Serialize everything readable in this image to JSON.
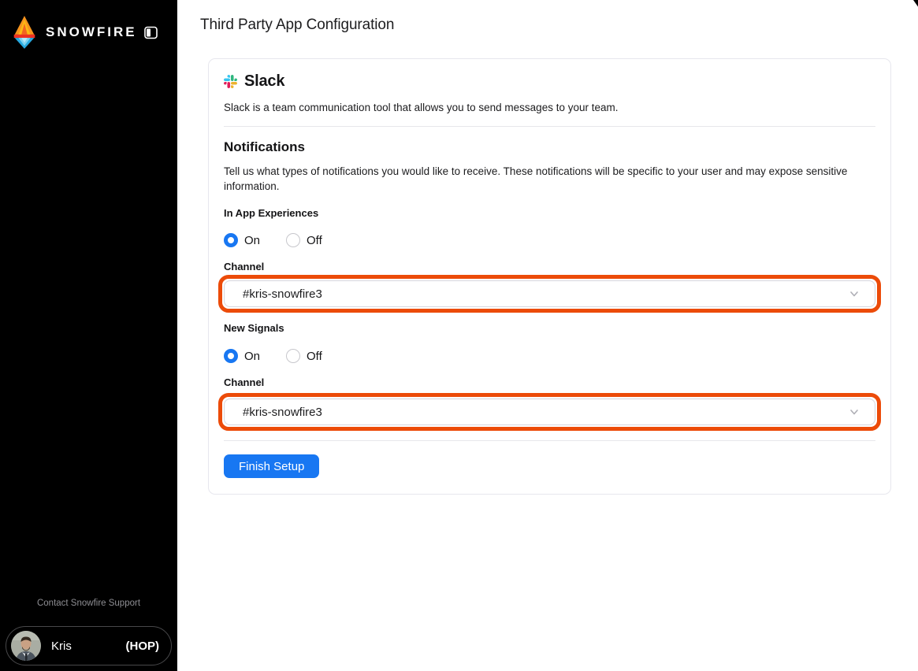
{
  "sidebar": {
    "brand": "SNOWFIRE",
    "support_link": "Contact Snowfire Support",
    "user": {
      "name": "Kris",
      "badge": "(HOP)"
    }
  },
  "header": {
    "title": "Third Party App Configuration"
  },
  "card": {
    "app": {
      "name": "Slack",
      "description": "Slack is a team communication tool that allows you to send messages to your team."
    },
    "notifications": {
      "heading": "Notifications",
      "description": "Tell us what types of notifications you would like to receive. These notifications will be specific to your user and may expose sensitive information.",
      "groups": [
        {
          "label": "In App Experiences",
          "options": [
            "On",
            "Off"
          ],
          "selected": "On",
          "channel_label": "Channel",
          "channel_value": "#kris-snowfire3"
        },
        {
          "label": "New Signals",
          "options": [
            "On",
            "Off"
          ],
          "selected": "On",
          "channel_label": "Channel",
          "channel_value": "#kris-snowfire3"
        }
      ]
    },
    "finish_button": "Finish Setup"
  },
  "icons": {
    "snowfire_logo": "flame-over-ice gem mark",
    "sidebar_toggle": "panel-left toggle",
    "slack": "slack four-color logo",
    "chevron_down": "v chevron",
    "annotation": "orange highlight box around channel selects"
  },
  "colors": {
    "accent_blue": "#1877f2",
    "annotation_orange": "#ec4b09",
    "sidebar_background": "#000000",
    "card_border": "#e7e7ee",
    "slack_blue": "#36c5f0",
    "slack_green": "#2eb67d",
    "slack_yellow": "#ecb22e",
    "slack_red": "#e01e5a"
  }
}
